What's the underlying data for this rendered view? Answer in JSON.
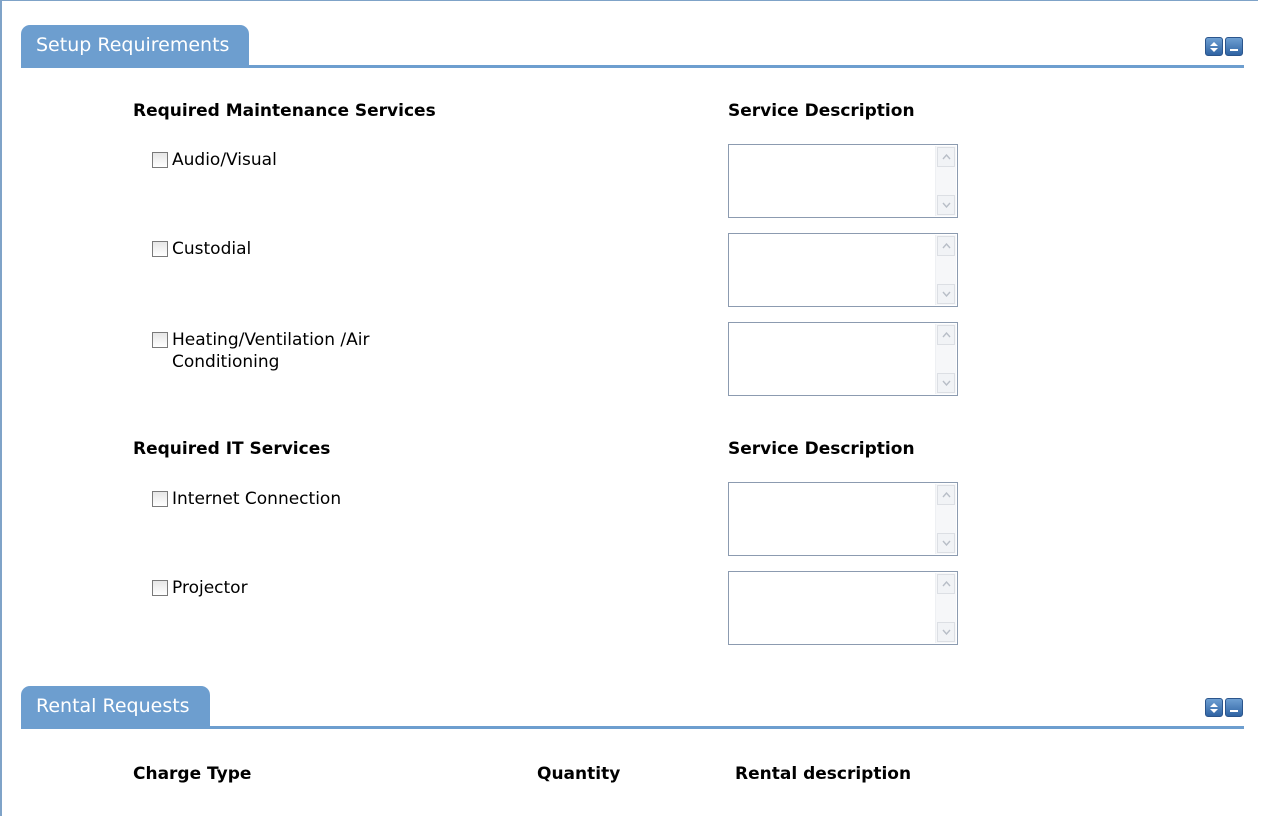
{
  "setup": {
    "tab_label": "Setup Requirements",
    "maintenance": {
      "heading": "Required Maintenance Services",
      "desc_heading": "Service Description",
      "items": [
        {
          "label": "Audio/Visual",
          "checked": false,
          "description": ""
        },
        {
          "label": "Custodial",
          "checked": false,
          "description": ""
        },
        {
          "label": "Heating/Ventilation /Air Conditioning",
          "checked": false,
          "description": ""
        }
      ]
    },
    "it": {
      "heading": "Required IT Services",
      "desc_heading": "Service Description",
      "items": [
        {
          "label": "Internet Connection",
          "checked": false,
          "description": ""
        },
        {
          "label": "Projector",
          "checked": false,
          "description": ""
        }
      ]
    }
  },
  "rental": {
    "tab_label": "Rental Requests",
    "columns": {
      "charge_type": "Charge Type",
      "quantity": "Quantity",
      "rental_description": "Rental description"
    }
  },
  "icons": {
    "expand": "up-down-arrows-icon",
    "collapse": "minus-icon",
    "scroll_up": "chevron-up-icon",
    "scroll_down": "chevron-down-icon"
  },
  "colors": {
    "tab_background": "#6d9ecf",
    "button_blue": "#2f63a3",
    "frame_border": "#7fa3c8"
  }
}
